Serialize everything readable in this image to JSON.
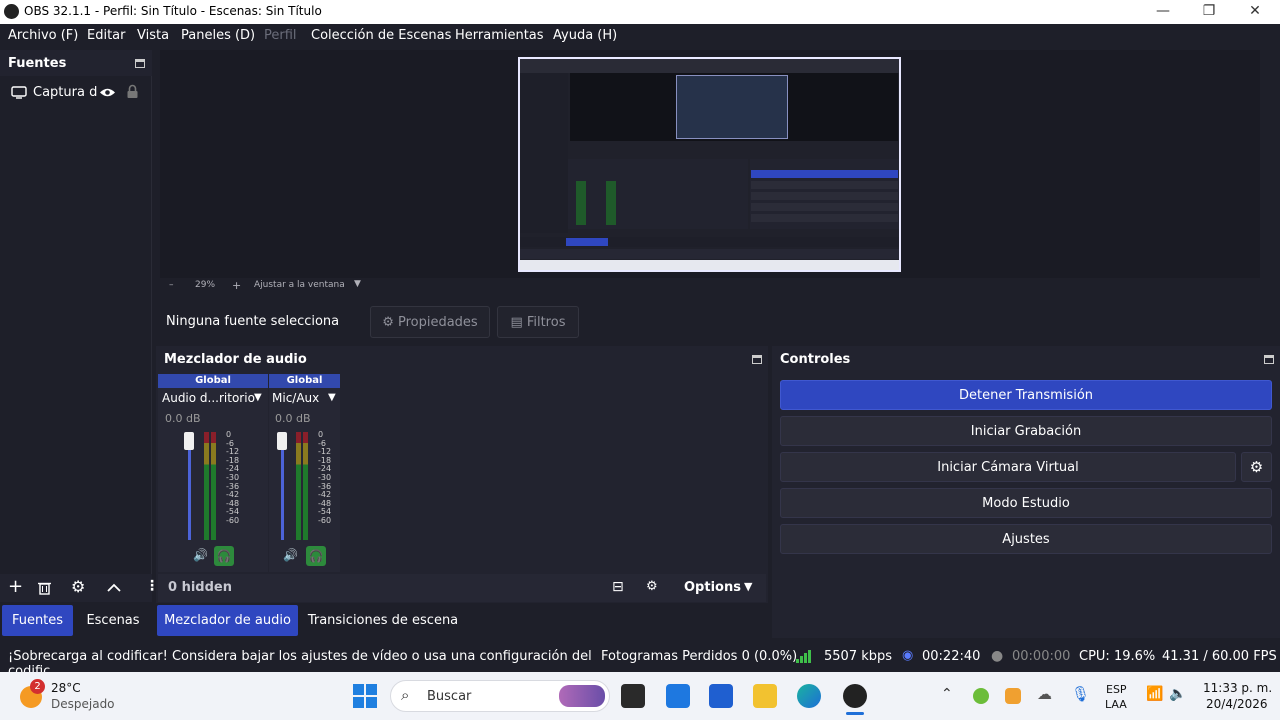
{
  "window": {
    "title": "OBS 32.1.1 - Perfil: Sin Título - Escenas: Sin Título",
    "minimize": "—",
    "maximize": "❐",
    "close": "✕"
  },
  "menu": [
    {
      "label": "Archivo (F)"
    },
    {
      "label": "Editar"
    },
    {
      "label": "Vista"
    },
    {
      "label": "Paneles (D)"
    },
    {
      "label": "Perfil"
    },
    {
      "label": "Colección de Escenas"
    },
    {
      "label": "Herramientas"
    },
    {
      "label": "Ayuda (H)"
    }
  ],
  "sources": {
    "title": "Fuentes",
    "items": [
      {
        "label": "Captura d"
      }
    ]
  },
  "preview": {
    "zoom": "29%",
    "fit_label": "Ajustar a la ventana"
  },
  "context_bar": {
    "no_source": "Ninguna fuente selecciona",
    "properties": "Propiedades",
    "filters": "Filtros"
  },
  "mixer": {
    "title": "Mezclador de audio",
    "channels": [
      {
        "scope": "Global",
        "name": "Audio d...ritorio",
        "db": "0.0 dB"
      },
      {
        "scope": "Global",
        "name": "Mic/Aux",
        "db": "0.0 dB"
      }
    ],
    "scale": [
      "0",
      "-6",
      "-12",
      "-18",
      "-24",
      "-30",
      "-36",
      "-42",
      "-48",
      "-54",
      "-60"
    ],
    "hidden": "0 hidden",
    "options": "Options"
  },
  "controls": {
    "title": "Controles",
    "stop_stream": "Detener Transmisión",
    "start_record": "Iniciar Grabación",
    "virtual_cam": "Iniciar Cámara Virtual",
    "studio_mode": "Modo Estudio",
    "settings": "Ajustes"
  },
  "dock_tabs": [
    {
      "label": "Fuentes",
      "active": true
    },
    {
      "label": "Escenas",
      "active": false
    },
    {
      "label": "Mezclador de audio",
      "active": true
    },
    {
      "label": "Transiciones de escena",
      "active": false
    }
  ],
  "status": {
    "warning": "¡Sobrecarga al codificar! Considera bajar los ajustes de vídeo o usa una configuración del codific.",
    "dropped": "Fotogramas Perdidos 0 (0.0%)",
    "bitrate": "5507 kbps",
    "stream_time": "00:22:40",
    "record_time": "00:00:00",
    "cpu": "CPU: 19.6%",
    "fps": "41.31 / 60.00 FPS"
  },
  "taskbar": {
    "weather_temp": "28°C",
    "weather_desc": "Despejado",
    "weather_badge": "2",
    "search": "Buscar",
    "lang_top": "ESP",
    "lang_bottom": "LAA",
    "time": "11:33 p. m.",
    "date": "20/4/2026"
  },
  "colors": {
    "accent": "#2f47c0",
    "bg": "#1e1f29",
    "panel": "#22232f"
  }
}
